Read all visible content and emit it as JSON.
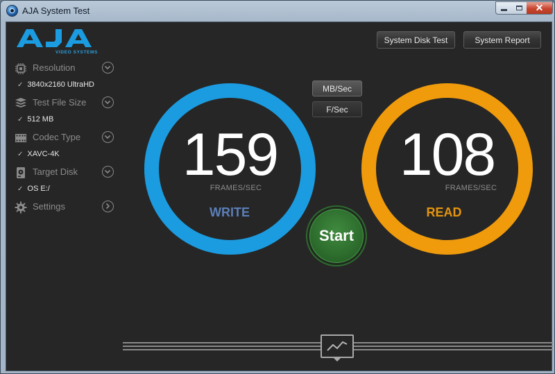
{
  "window": {
    "title": "AJA System Test",
    "close_glyph": "✕"
  },
  "logo": {
    "text": "AJA",
    "subtext": "VIDEO SYSTEMS",
    "color": "#1b9ce0"
  },
  "sidebar": {
    "items": [
      {
        "label": "Resolution",
        "icon": "resolution-chip-icon",
        "value": "3840x2160 UltraHD",
        "chevron": "chevron-down-icon"
      },
      {
        "label": "Test File Size",
        "icon": "stack-icon",
        "value": "512 MB",
        "chevron": "chevron-down-icon"
      },
      {
        "label": "Codec Type",
        "icon": "film-strip-icon",
        "value": "XAVC-4K",
        "chevron": "chevron-down-icon"
      },
      {
        "label": "Target Disk",
        "icon": "disk-icon",
        "value": "OS E:/",
        "chevron": "chevron-down-icon"
      },
      {
        "label": "Settings",
        "icon": "gear-icon",
        "value": "",
        "chevron": "chevron-right-icon"
      }
    ],
    "check_glyph": "✓"
  },
  "toolbar": {
    "system_disk_test": "System Disk Test",
    "system_report": "System Report"
  },
  "units": {
    "mb_sec": "MB/Sec",
    "f_sec": "F/Sec",
    "selected": "MB/Sec"
  },
  "write": {
    "value": "159",
    "unit": "FRAMES/SEC",
    "label": "WRITE",
    "ring_color": "#1b9ce0",
    "label_color": "#5b7fb8"
  },
  "read": {
    "value": "108",
    "unit": "FRAMES/SEC",
    "label": "READ",
    "ring_color": "#f09b0c",
    "label_color": "#e5940e"
  },
  "start": {
    "label": "Start",
    "color": "#2f7a2f"
  },
  "graph": {
    "icon": "line-graph-icon"
  }
}
